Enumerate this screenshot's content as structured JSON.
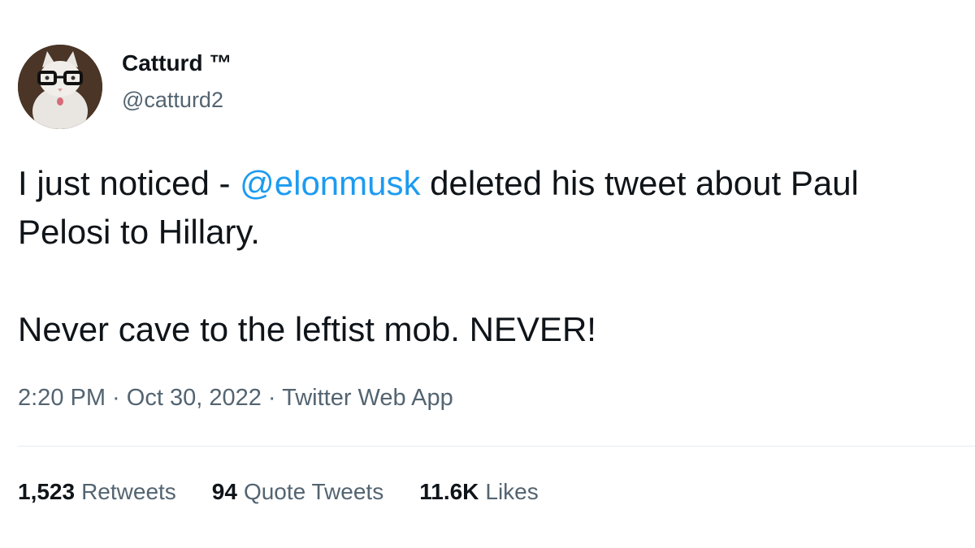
{
  "author": {
    "display_name": "Catturd ™",
    "handle": "@catturd2",
    "avatar_icon": "cat-with-glasses-avatar"
  },
  "tweet": {
    "line1_before": "I just noticed - ",
    "mention": "@elonmusk",
    "line1_after": " deleted his tweet about Paul Pelosi to Hillary.",
    "paragraph2": "Never cave to the leftist mob. NEVER!",
    "mention_color": "#1d9bf0"
  },
  "meta": {
    "time": "2:20 PM",
    "sep1": " · ",
    "date": "Oct 30, 2022",
    "sep2": " · ",
    "source": "Twitter Web App"
  },
  "stats": {
    "retweets_count": "1,523",
    "retweets_label": "Retweets",
    "quotes_count": "94",
    "quotes_label": "Quote Tweets",
    "likes_count": "11.6K",
    "likes_label": "Likes"
  }
}
